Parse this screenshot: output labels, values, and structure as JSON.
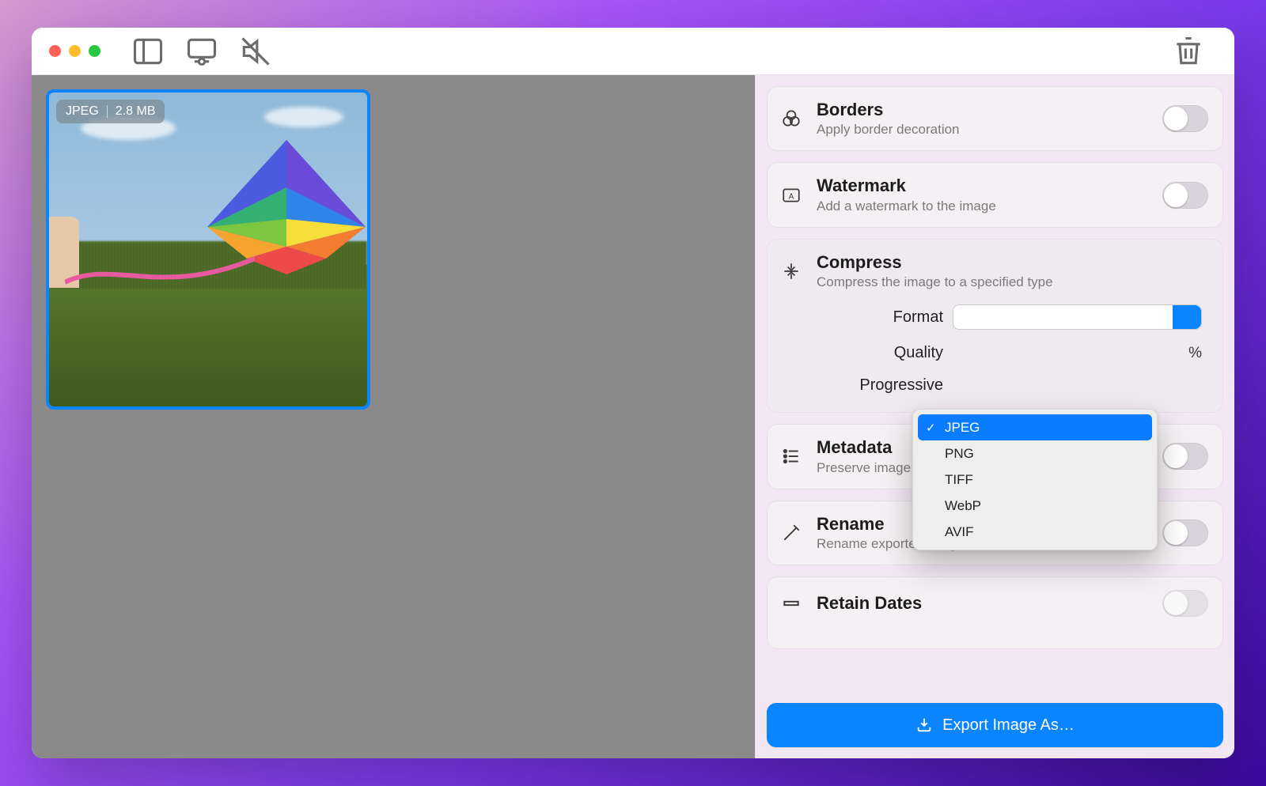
{
  "thumbnail": {
    "format_tag": "JPEG",
    "size_tag": "2.8 MB"
  },
  "panels": {
    "borders": {
      "title": "Borders",
      "subtitle": "Apply border decoration"
    },
    "watermark": {
      "title": "Watermark",
      "subtitle": "Add a watermark to the image"
    },
    "compress": {
      "title": "Compress",
      "subtitle": "Compress the image to a specified type",
      "format_label": "Format",
      "quality_label": "Quality",
      "progressive_label": "Progressive",
      "quality_value_suffix": "%",
      "format_options": [
        "JPEG",
        "PNG",
        "TIFF",
        "WebP",
        "AVIF"
      ],
      "format_selected": "JPEG"
    },
    "metadata": {
      "title": "Metadata",
      "subtitle": "Preserve image metadata"
    },
    "rename": {
      "title": "Rename",
      "subtitle": "Rename exported images"
    },
    "retain_dates": {
      "title": "Retain Dates"
    }
  },
  "export_button": "Export Image As…"
}
